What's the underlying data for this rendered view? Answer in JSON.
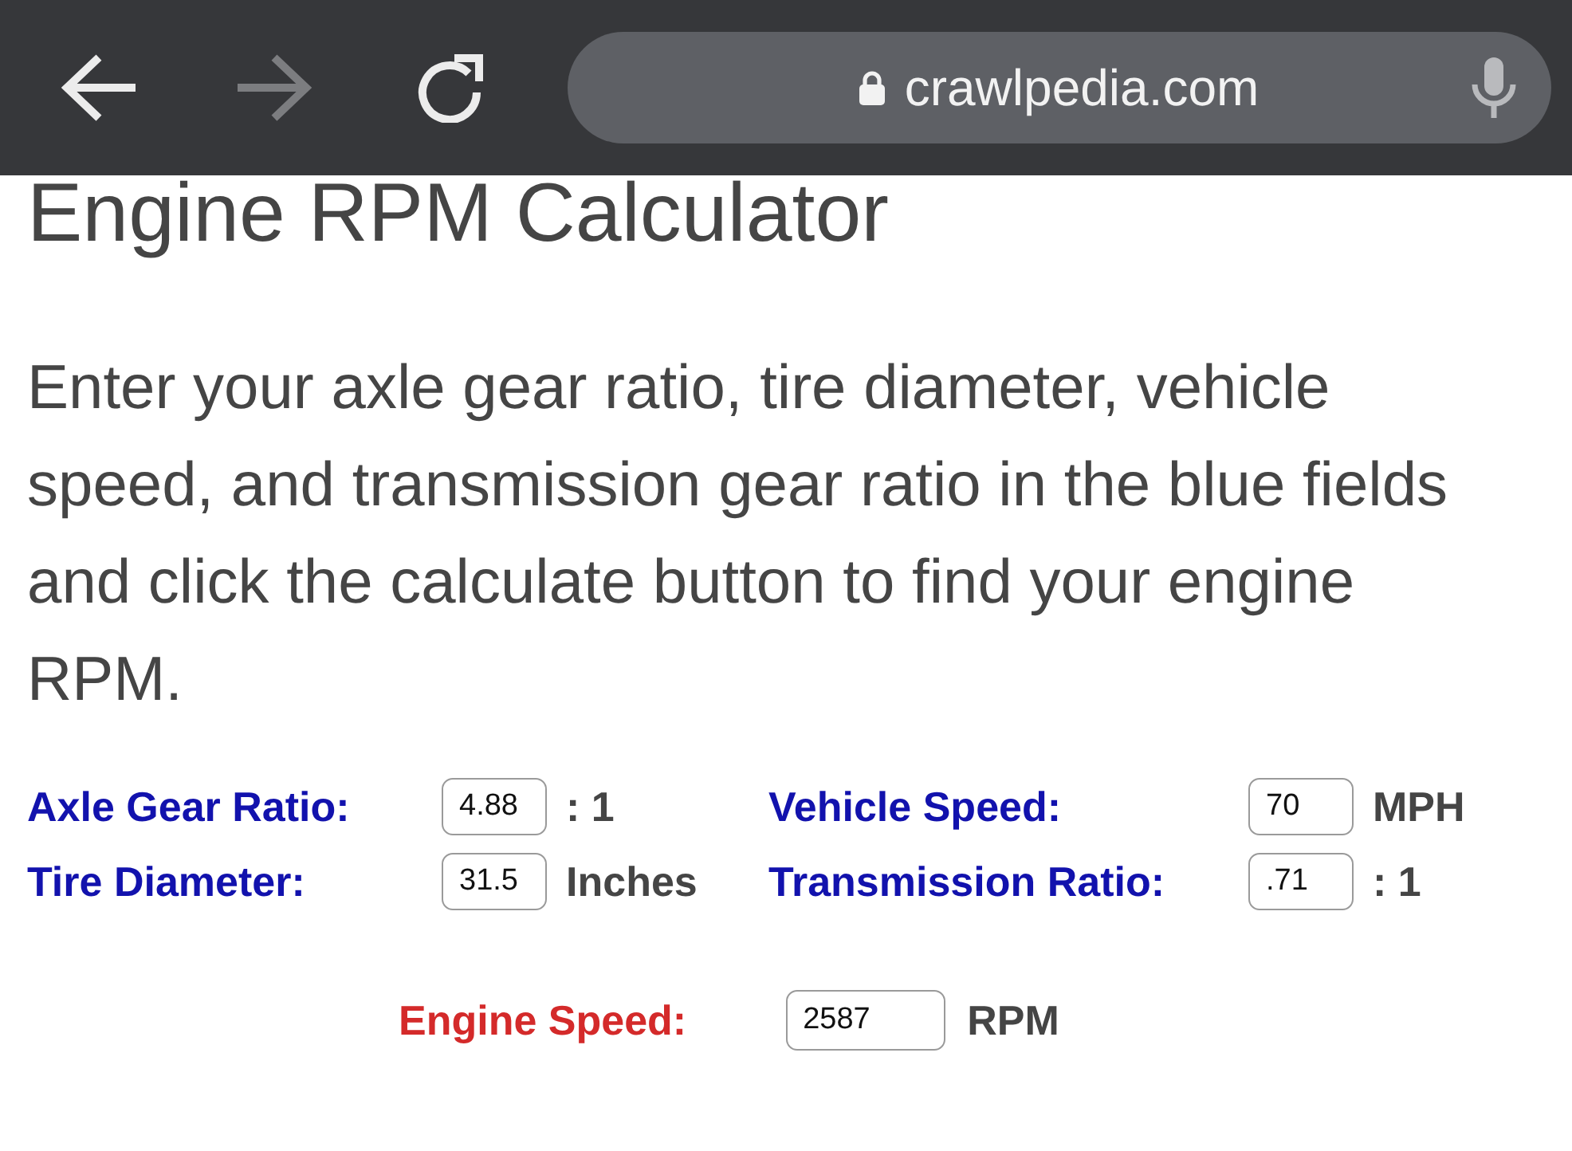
{
  "toolbar": {
    "buttons": [
      {
        "kind": "back",
        "disabled": false
      },
      {
        "kind": "forward",
        "disabled": true
      },
      {
        "kind": "reload",
        "disabled": false
      }
    ],
    "address_bar": {
      "url": "crawlpedia.com",
      "secure": true
    }
  },
  "page": {
    "title": "Engine RPM Calculator",
    "intro": "Enter your axle gear ratio, tire diameter, vehicle speed, and transmission gear ratio in the blue fields and click the calculate button to find your engine RPM."
  },
  "form": {
    "fields": [
      {
        "label": "Axle Gear Ratio:",
        "value": "4.88",
        "unit": ": 1"
      },
      {
        "label": "Vehicle Speed:",
        "value": "70",
        "unit": "MPH"
      },
      {
        "label": "Tire Diameter:",
        "value": "31.5",
        "unit": "Inches"
      },
      {
        "label": "Transmission Ratio:",
        "value": ".71",
        "unit": ": 1"
      }
    ],
    "result": {
      "label": "Engine Speed:",
      "value": "2587",
      "unit": "RPM"
    }
  }
}
